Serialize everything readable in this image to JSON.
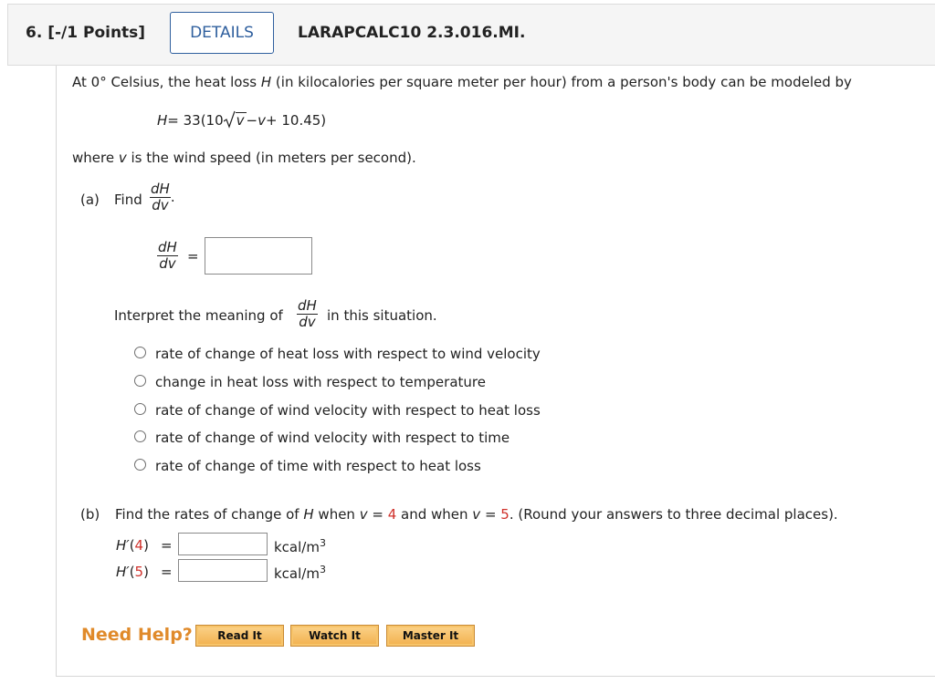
{
  "header": {
    "question_number": "6.  [-/1 Points]",
    "details_label": "DETAILS",
    "problem_code": "LARAPCALC10 2.3.016.MI."
  },
  "intro": {
    "text_before": "At 0° Celsius, the heat loss ",
    "var_H": "H",
    "text_after": " (in kilocalories per square meter per hour) from a person's body can be modeled by"
  },
  "equation": {
    "lhs": "H",
    "eq_start": " = 33(10",
    "sqrt_var": "v",
    "eq_mid": " − ",
    "v2": "v",
    "eq_end": " + 10.45)"
  },
  "where": {
    "text_before": "where ",
    "var_v": "v",
    "text_after": " is the wind speed (in meters per second)."
  },
  "part_a": {
    "label": "(a)",
    "find": "Find",
    "frac_num": "dH",
    "frac_den": "dv",
    "period": ".",
    "answer_eq": "=",
    "answer_value": "",
    "interpret_before": "Interpret the meaning of",
    "interpret_after": "in this situation.",
    "options": [
      "rate of change of heat loss with respect to wind velocity",
      "change in heat loss with respect to temperature",
      "rate of change of wind velocity with respect to heat loss",
      "rate of change of wind velocity with respect to time",
      "rate of change of time with respect to heat loss"
    ]
  },
  "part_b": {
    "label": "(b)",
    "text1": "Find the rates of change of ",
    "var_H": "H",
    "text2": " when ",
    "var_v1": "v",
    "eq1": " = ",
    "val1": "4",
    "text3": " and when ",
    "var_v2": "v",
    "eq2": " = ",
    "val2": "5",
    "text4": ". (Round your answers to three decimal places).",
    "rows": [
      {
        "fn": "H′",
        "open": "(",
        "arg": "4",
        "close": ")",
        "eq": "=",
        "value": "",
        "unit": "kcal/m",
        "exp": "3"
      },
      {
        "fn": "H′",
        "open": "(",
        "arg": "5",
        "close": ")",
        "eq": "=",
        "value": "",
        "unit": "kcal/m",
        "exp": "3"
      }
    ]
  },
  "help": {
    "label": "Need Help?",
    "buttons": [
      "Read It",
      "Watch It",
      "Master It"
    ]
  },
  "colors": {
    "accent_blue": "#2f5f9e",
    "highlight_red": "#d0302a",
    "help_orange": "#e08a2a"
  }
}
